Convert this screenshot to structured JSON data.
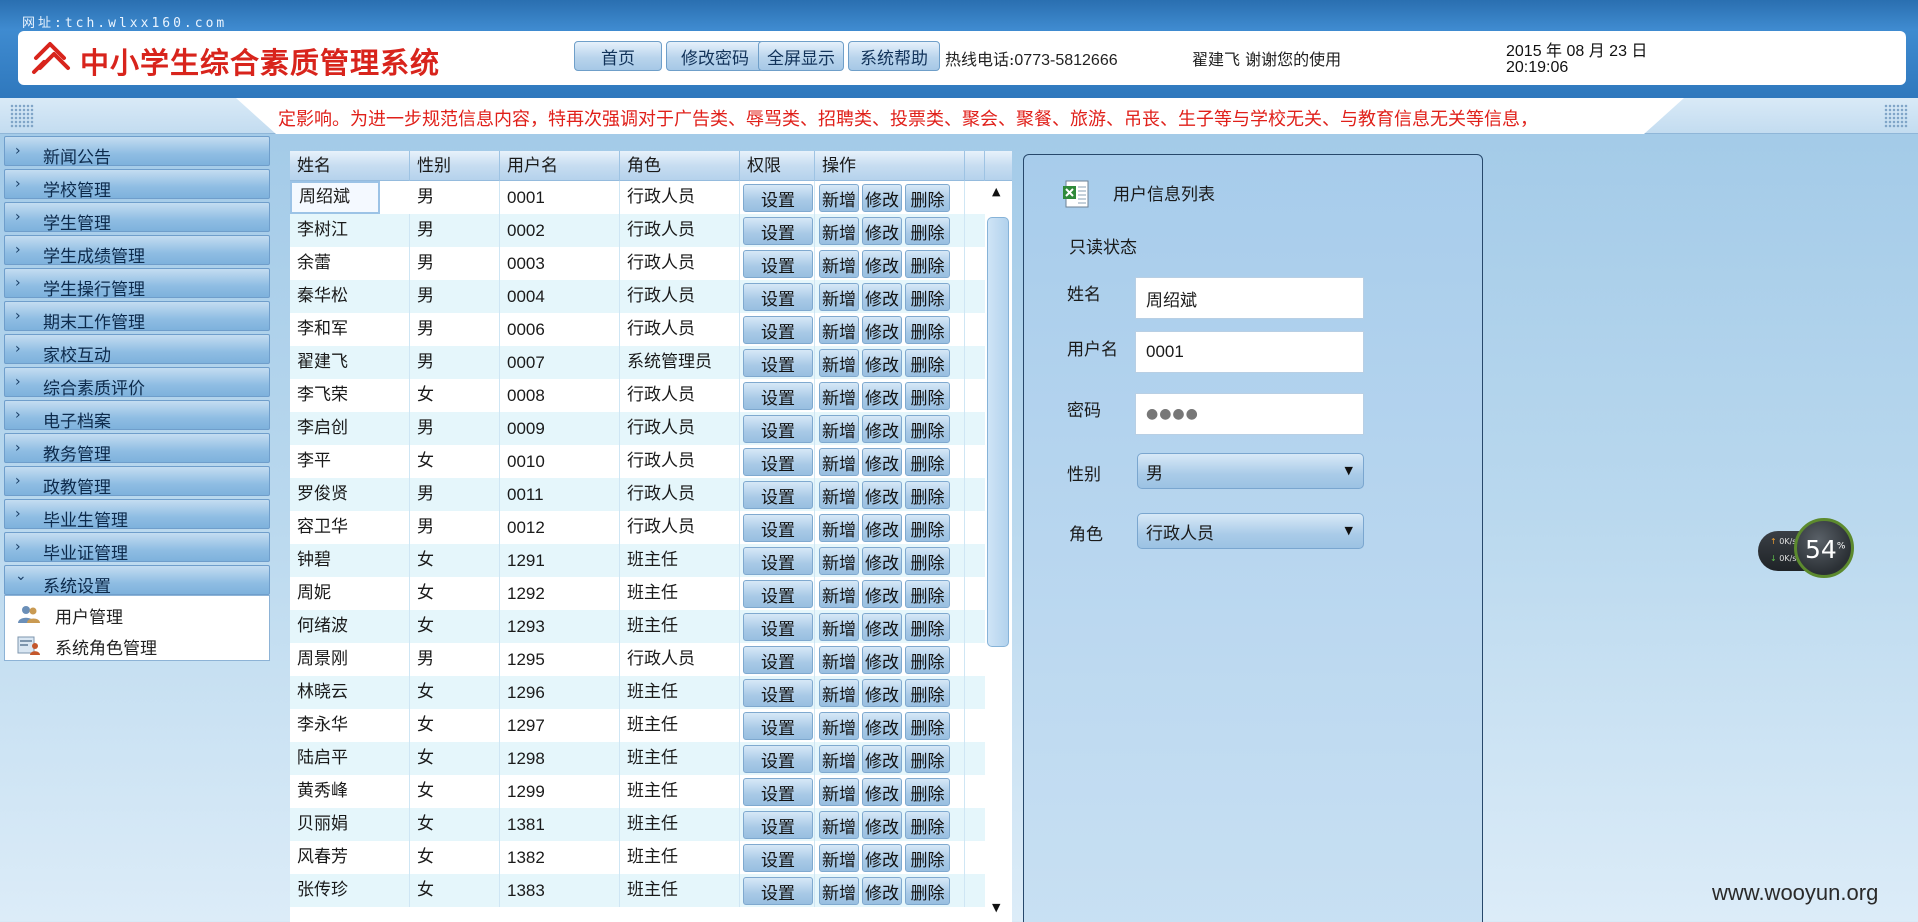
{
  "header": {
    "site_url": "网址:tch.wlxx160.com",
    "system_title": "中小学生综合素质管理系统",
    "nav": {
      "home": "首页",
      "change_password": "修改密码",
      "fullscreen": "全屏显示",
      "help": "系统帮助"
    },
    "hotline_label": "热线电话:",
    "hotline_number": "0773-5812666",
    "greeting": "翟建飞 谢谢您的使用",
    "date": "2015 年 08 月 23 日",
    "time": "20:19:06"
  },
  "marquee": {
    "text": "定影响。为进一步规范信息内容，特再次强调对于广告类、辱骂类、招聘类、投票类、聚会、聚餐、旅游、吊丧、生子等与学校无关、与教育信息无关等信息，"
  },
  "sidebar": {
    "items": [
      {
        "label": "新闻公告"
      },
      {
        "label": "学校管理"
      },
      {
        "label": "学生管理"
      },
      {
        "label": "学生成绩管理"
      },
      {
        "label": "学生操行管理"
      },
      {
        "label": "期末工作管理"
      },
      {
        "label": "家校互动"
      },
      {
        "label": "综合素质评价"
      },
      {
        "label": "电子档案"
      },
      {
        "label": "教务管理"
      },
      {
        "label": "政教管理"
      },
      {
        "label": "毕业生管理"
      },
      {
        "label": "毕业证管理"
      },
      {
        "label": "系统设置"
      }
    ],
    "chevron_collapsed": "›",
    "chevron_expanded": "⌄",
    "submenu": [
      {
        "label": "用户管理",
        "icon": "users-icon"
      },
      {
        "label": "系统角色管理",
        "icon": "role-icon"
      }
    ]
  },
  "table": {
    "columns": [
      "姓名",
      "性别",
      "用户名",
      "角色",
      "权限",
      "操作"
    ],
    "buttons": {
      "permission": "设置",
      "add": "新增",
      "edit": "修改",
      "delete": "删除"
    },
    "rows": [
      {
        "name": "周绍斌",
        "gender": "男",
        "username": "0001",
        "role": "行政人员"
      },
      {
        "name": "李树江",
        "gender": "男",
        "username": "0002",
        "role": "行政人员"
      },
      {
        "name": "余蕾",
        "gender": "男",
        "username": "0003",
        "role": "行政人员"
      },
      {
        "name": "秦华松",
        "gender": "男",
        "username": "0004",
        "role": "行政人员"
      },
      {
        "name": "李和军",
        "gender": "男",
        "username": "0006",
        "role": "行政人员"
      },
      {
        "name": "翟建飞",
        "gender": "男",
        "username": "0007",
        "role": "系统管理员"
      },
      {
        "name": "李飞荣",
        "gender": "女",
        "username": "0008",
        "role": "行政人员"
      },
      {
        "name": "李启创",
        "gender": "男",
        "username": "0009",
        "role": "行政人员"
      },
      {
        "name": "李平",
        "gender": "女",
        "username": "0010",
        "role": "行政人员"
      },
      {
        "name": "罗俊贤",
        "gender": "男",
        "username": "0011",
        "role": "行政人员"
      },
      {
        "name": "容卫华",
        "gender": "男",
        "username": "0012",
        "role": "行政人员"
      },
      {
        "name": "钟碧",
        "gender": "女",
        "username": "1291",
        "role": "班主任"
      },
      {
        "name": "周妮",
        "gender": "女",
        "username": "1292",
        "role": "班主任"
      },
      {
        "name": "何绪波",
        "gender": "女",
        "username": "1293",
        "role": "班主任"
      },
      {
        "name": "周景刚",
        "gender": "男",
        "username": "1295",
        "role": "行政人员"
      },
      {
        "name": "林晓云",
        "gender": "女",
        "username": "1296",
        "role": "班主任"
      },
      {
        "name": "李永华",
        "gender": "女",
        "username": "1297",
        "role": "班主任"
      },
      {
        "name": "陆启平",
        "gender": "女",
        "username": "1298",
        "role": "班主任"
      },
      {
        "name": "黄秀峰",
        "gender": "女",
        "username": "1299",
        "role": "班主任"
      },
      {
        "name": "贝丽娟",
        "gender": "女",
        "username": "1381",
        "role": "班主任"
      },
      {
        "name": "风春芳",
        "gender": "女",
        "username": "1382",
        "role": "班主任"
      },
      {
        "name": "张传珍",
        "gender": "女",
        "username": "1383",
        "role": "班主任"
      }
    ],
    "scroll_up": "▲",
    "scroll_down": "▼"
  },
  "detail": {
    "title": "用户信息列表",
    "readonly": "只读状态",
    "name_label": "姓名",
    "name_value": "周绍斌",
    "username_label": "用户名",
    "username_value": "0001",
    "password_label": "密码",
    "password_value": "●●●●",
    "gender_label": "性别",
    "gender_value": "男",
    "role_label": "角色",
    "role_value": "行政人员",
    "select_arrow": "▼"
  },
  "speed_widget": {
    "up_rate": "0K/s",
    "down_rate": "0K/s",
    "percent": "54",
    "percent_unit": "%",
    "up_arrow": "↑",
    "down_arrow": "↓"
  },
  "watermark": "www.wooyun.org",
  "colors": {
    "title_red": "#d8241c",
    "marquee_red": "#e0201a",
    "header_blue": "#2f78bd"
  }
}
